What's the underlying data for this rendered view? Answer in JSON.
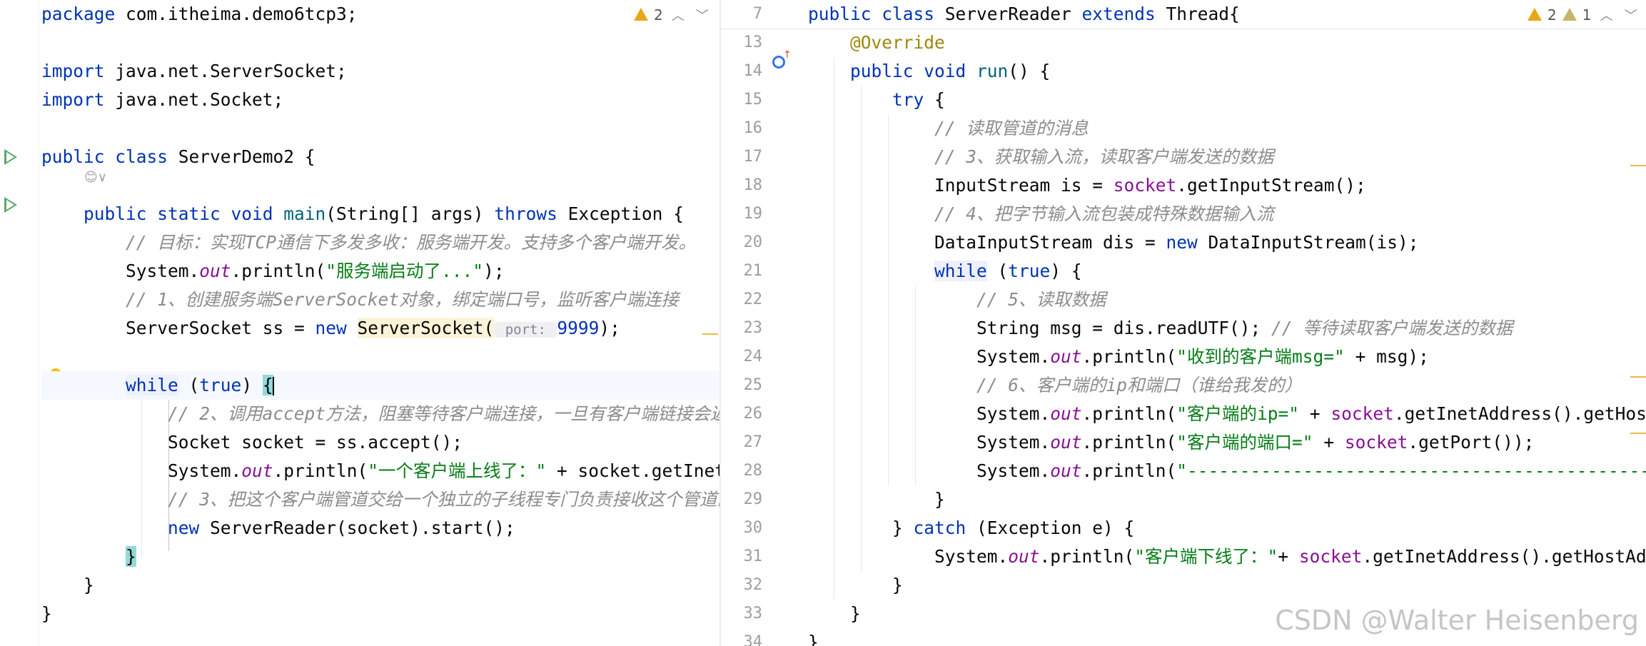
{
  "left": {
    "inspection": {
      "warnings": "2"
    },
    "ai_hint": "😊∨",
    "lines": [
      [
        {
          "t": "package ",
          "c": "kw"
        },
        {
          "t": "com.itheima.demo6tcp3;",
          "c": ""
        }
      ],
      [],
      [
        {
          "t": "import ",
          "c": "kw"
        },
        {
          "t": "java.net.ServerSocket;",
          "c": ""
        }
      ],
      [
        {
          "t": "import ",
          "c": "kw"
        },
        {
          "t": "java.net.Socket;",
          "c": ""
        }
      ],
      [],
      [
        {
          "t": "public class ",
          "c": "kw"
        },
        {
          "t": "ServerDemo2 {",
          "c": ""
        }
      ],
      [],
      [
        {
          "t": "    "
        },
        {
          "t": "public static void ",
          "c": "kw"
        },
        {
          "t": "main",
          "c": "mth"
        },
        {
          "t": "(String[] args) "
        },
        {
          "t": "throws ",
          "c": "kw"
        },
        {
          "t": "Exception {"
        }
      ],
      [
        {
          "t": "        "
        },
        {
          "t": "// 目标：实现TCP通信下多发多收：服务端开发。支持多个客户端开发。",
          "c": "cmt"
        }
      ],
      [
        {
          "t": "        System."
        },
        {
          "t": "out",
          "c": "fld"
        },
        {
          "t": ".println("
        },
        {
          "t": "\"服务端启动了...\"",
          "c": "str"
        },
        {
          "t": ");"
        }
      ],
      [
        {
          "t": "        "
        },
        {
          "t": "// 1、创建服务端ServerSocket对象，绑定端口号，监听客户端连接",
          "c": "cmt"
        }
      ],
      [
        {
          "t": "        ServerSocket ss = "
        },
        {
          "t": "new ",
          "c": "kw"
        },
        {
          "t": "ServerSocket(",
          "c": "hl-yellow"
        },
        {
          "t": " port: ",
          "c": "hint"
        },
        {
          "t": "9999",
          "c": "kw"
        },
        {
          "t": ");"
        }
      ],
      [],
      [
        {
          "t": "        "
        },
        {
          "t": "while",
          "c": "kw hl-kw"
        },
        {
          "t": " ("
        },
        {
          "t": "true",
          "c": "kw"
        },
        {
          "t": ") "
        },
        {
          "t": "{",
          "c": "brace-match"
        },
        {
          "t": "",
          "c": "caret"
        }
      ],
      [
        {
          "t": "            "
        },
        {
          "t": "// 2、调用accept方法，阻塞等待客户端连接，一旦有客户端链接会返",
          "c": "cmt"
        }
      ],
      [
        {
          "t": "            Socket socket = ss.accept();"
        }
      ],
      [
        {
          "t": "            System."
        },
        {
          "t": "out",
          "c": "fld"
        },
        {
          "t": ".println("
        },
        {
          "t": "\"一个客户端上线了：\"",
          "c": "str"
        },
        {
          "t": " + socket.getInet"
        }
      ],
      [
        {
          "t": "            "
        },
        {
          "t": "// 3、把这个客户端管道交给一个独立的子线程专门负责接收这个管道的",
          "c": "cmt"
        }
      ],
      [
        {
          "t": "            "
        },
        {
          "t": "new ",
          "c": "kw"
        },
        {
          "t": "ServerReader(socket).start();"
        }
      ],
      [
        {
          "t": "        "
        },
        {
          "t": "}",
          "c": "brace-match"
        }
      ],
      [
        {
          "t": "    }"
        }
      ],
      [
        {
          "t": "}"
        }
      ]
    ]
  },
  "right": {
    "inspection": {
      "warnings": "2",
      "weak_warnings": "1"
    },
    "line_numbers": [
      "7",
      "13",
      "14",
      "15",
      "16",
      "17",
      "18",
      "19",
      "20",
      "21",
      "22",
      "23",
      "24",
      "25",
      "26",
      "27",
      "28",
      "29",
      "30",
      "31",
      "32",
      "33",
      "34"
    ],
    "lines": [
      [
        {
          "t": "public class ",
          "c": "kw"
        },
        {
          "t": "ServerReader "
        },
        {
          "t": "extends ",
          "c": "kw"
        },
        {
          "t": "Thread{"
        }
      ],
      [
        {
          "t": "    "
        },
        {
          "t": "@Override",
          "c": "ann"
        }
      ],
      [
        {
          "t": "    "
        },
        {
          "t": "public void ",
          "c": "kw"
        },
        {
          "t": "run",
          "c": "mth"
        },
        {
          "t": "() {"
        }
      ],
      [
        {
          "t": "        "
        },
        {
          "t": "try ",
          "c": "kw"
        },
        {
          "t": "{"
        }
      ],
      [
        {
          "t": "            "
        },
        {
          "t": "// 读取管道的消息",
          "c": "cmt"
        }
      ],
      [
        {
          "t": "            "
        },
        {
          "t": "// 3、获取输入流，读取客户端发送的数据",
          "c": "cmt"
        }
      ],
      [
        {
          "t": "            InputStream is = "
        },
        {
          "t": "socket",
          "c": "inst"
        },
        {
          "t": ".getInputStream();"
        }
      ],
      [
        {
          "t": "            "
        },
        {
          "t": "// 4、把字节输入流包装成特殊数据输入流",
          "c": "cmt"
        }
      ],
      [
        {
          "t": "            DataInputStream dis = "
        },
        {
          "t": "new ",
          "c": "kw"
        },
        {
          "t": "DataInputStream(is);"
        }
      ],
      [
        {
          "t": "            "
        },
        {
          "t": "while",
          "c": "kw hl-kw"
        },
        {
          "t": " ("
        },
        {
          "t": "true",
          "c": "kw"
        },
        {
          "t": ") {"
        }
      ],
      [
        {
          "t": "                "
        },
        {
          "t": "// 5、读取数据",
          "c": "cmt"
        }
      ],
      [
        {
          "t": "                String msg = dis.readUTF(); "
        },
        {
          "t": "// 等待读取客户端发送的数据",
          "c": "cmt"
        }
      ],
      [
        {
          "t": "                System."
        },
        {
          "t": "out",
          "c": "fld"
        },
        {
          "t": ".println("
        },
        {
          "t": "\"收到的客户端msg=\"",
          "c": "str"
        },
        {
          "t": " + msg);"
        }
      ],
      [
        {
          "t": "                "
        },
        {
          "t": "// 6、客户端的ip和端口（谁给我发的）",
          "c": "cmt"
        }
      ],
      [
        {
          "t": "                System."
        },
        {
          "t": "out",
          "c": "fld"
        },
        {
          "t": ".println("
        },
        {
          "t": "\"客户端的ip=\"",
          "c": "str"
        },
        {
          "t": " + "
        },
        {
          "t": "socket",
          "c": "inst"
        },
        {
          "t": ".getInetAddress().getHost"
        }
      ],
      [
        {
          "t": "                System."
        },
        {
          "t": "out",
          "c": "fld"
        },
        {
          "t": ".println("
        },
        {
          "t": "\"客户端的端口=\"",
          "c": "str"
        },
        {
          "t": " + "
        },
        {
          "t": "socket",
          "c": "inst"
        },
        {
          "t": ".getPort());"
        }
      ],
      [
        {
          "t": "                System."
        },
        {
          "t": "out",
          "c": "fld"
        },
        {
          "t": ".println("
        },
        {
          "t": "\"-----------------------------------------------------------",
          "c": "str"
        }
      ],
      [
        {
          "t": "            }"
        }
      ],
      [
        {
          "t": "        } "
        },
        {
          "t": "catch ",
          "c": "kw"
        },
        {
          "t": "(Exception e) {"
        }
      ],
      [
        {
          "t": "            System."
        },
        {
          "t": "out",
          "c": "fld"
        },
        {
          "t": ".println("
        },
        {
          "t": "\"客户端下线了：\"",
          "c": "str"
        },
        {
          "t": "+ "
        },
        {
          "t": "socket",
          "c": "inst"
        },
        {
          "t": ".getInetAddress().getHostAdc"
        }
      ],
      [
        {
          "t": "        }"
        }
      ],
      [
        {
          "t": "    }"
        }
      ],
      [
        {
          "t": "}"
        }
      ]
    ]
  },
  "watermark": "CSDN @Walter Heisenberg"
}
